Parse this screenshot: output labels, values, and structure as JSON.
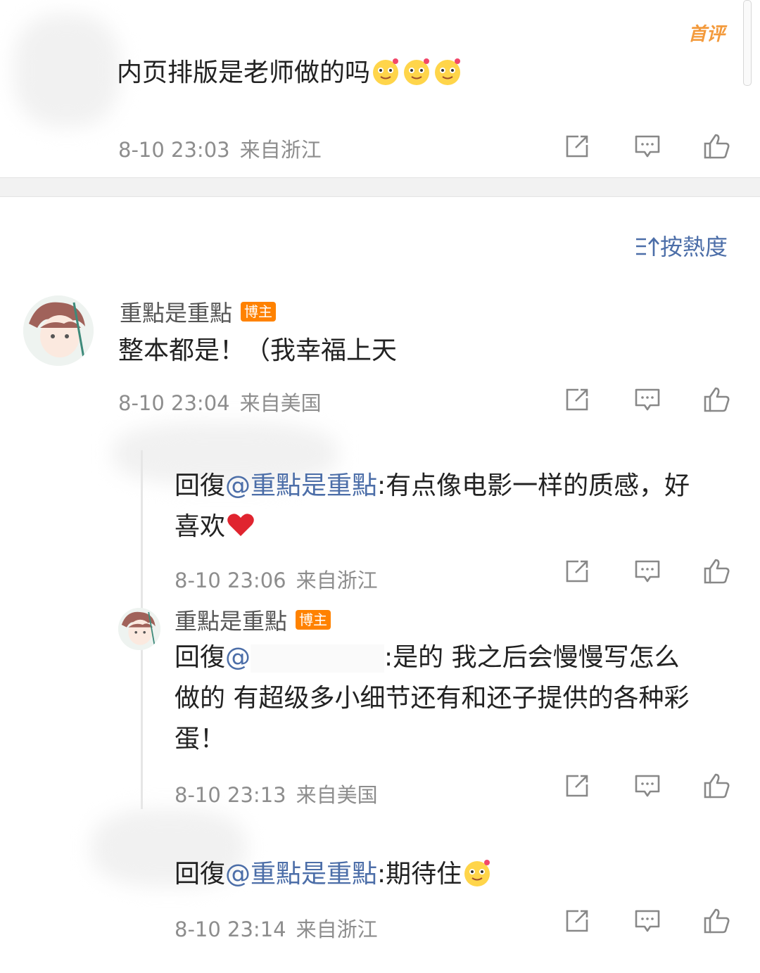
{
  "top_comment": {
    "badge_first": "首评",
    "text": "内页排版是老师做的吗",
    "emoji_count": 3,
    "time": "8-10 23:03",
    "location": "来自浙江"
  },
  "sort": {
    "label": "按熱度"
  },
  "main_comment": {
    "username": "重點是重點",
    "badge": "博主",
    "text": "整本都是！（我幸福上天",
    "time": "8-10 23:04",
    "location": "来自美国"
  },
  "replies": [
    {
      "prefix": "回復",
      "mention": "@重點是重點",
      "text_line1": ":有点像电影一样的质感，好",
      "text_line2": "喜欢",
      "time": "8-10 23:06",
      "location": "来自浙江"
    },
    {
      "username": "重點是重點",
      "badge": "博主",
      "prefix": "回復",
      "mention": "@",
      "text_line1": ":是的 我之后会慢慢写怎么",
      "text_line2": "做的 有超级多小细节还有和还子提供的各种彩",
      "text_line3": "蛋！",
      "time": "8-10 23:13",
      "location": "来自美国"
    },
    {
      "prefix": "回復",
      "mention": "@重點是重點",
      "text_line1": ":期待住",
      "time": "8-10 23:14",
      "location": "来自浙江"
    }
  ],
  "icons": [
    "share-icon",
    "comment-icon",
    "like-icon",
    "heart-emoji",
    "smile-emoji",
    "sort-icon"
  ],
  "colors": {
    "badge": "#ff8200",
    "mention": "#4c6ea8",
    "meta": "#8d8d8d",
    "heart": "#e0242f"
  }
}
